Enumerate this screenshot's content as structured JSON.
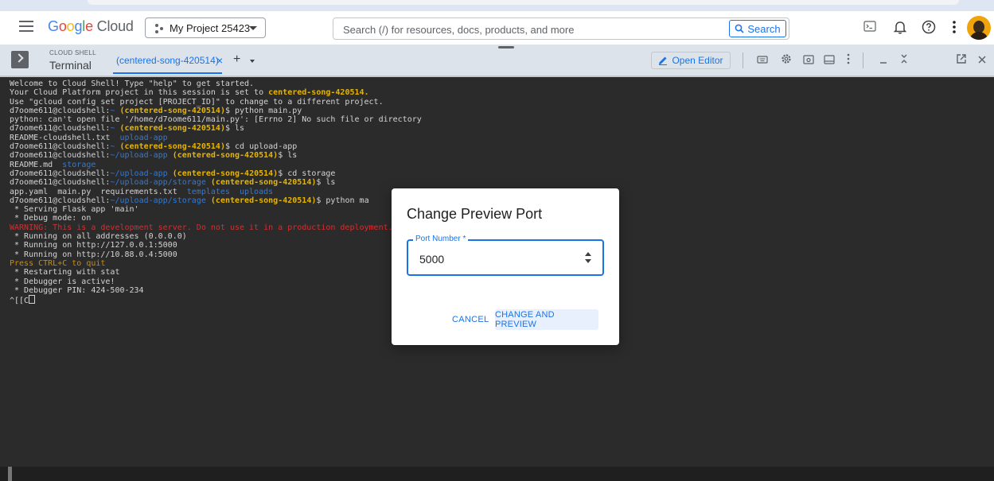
{
  "header": {
    "logo": {
      "g": "G",
      "o1": "o",
      "o2": "o",
      "g2": "g",
      "l": "l",
      "e": "e",
      "cloud": " Cloud"
    },
    "project_selector": "My Project 25423",
    "search_placeholder": "Search (/) for resources, docs, products, and more",
    "search_button": "Search"
  },
  "shell": {
    "section_label": "CLOUD SHELL",
    "title": "Terminal",
    "tab_label": "(centered-song-420514)",
    "tab_close": "×",
    "tab_add": "+",
    "open_editor": "Open Editor"
  },
  "terminal": {
    "user": "d7oome611@cloudshell",
    "project": "(centered-song-420514)",
    "lines": {
      "welcome": "Welcome to Cloud Shell! Type \"help\" to get started.",
      "project_set_prefix": "Your Cloud Platform project in this session is set to ",
      "project_id": "centered-song-420514.",
      "use_gcloud": "Use \"gcloud config set project [PROJECT_ID]\" to change to a different project.",
      "cmd_python": "python main.py",
      "error": "python: can't open file '/home/d7oome611/main.py': [Errno 2] No such file or directory",
      "cmd_ls": "ls",
      "ls1_file": "README-cloudshell.txt",
      "ls1_dir": "upload-app",
      "cmd_cd_upload": "cd upload-app",
      "ls2_file": "README.md",
      "ls2_dir": "storage",
      "cmd_cd_storage": "cd storage",
      "ls3_files": "app.yaml  main.py  requirements.txt",
      "ls3_dir1": "templates",
      "ls3_dir2": "uploads",
      "cmd_python_trunc": "python ma",
      "serving": " * Serving Flask app 'main'",
      "debug_mode": " * Debug mode: on",
      "warning": "WARNING: This is a development server. Do not use it in a production deployment. Use a production WSGI server instead.",
      "running_all": " * Running on all addresses (0.0.0.0)",
      "running_local": " * Running on http://127.0.0.1:5000",
      "running_ip": " * Running on http://10.88.0.4:5000",
      "press_ctrl": "Press CTRL+C to quit",
      "restarting": " * Restarting with stat",
      "debugger_active": " * Debugger is active!",
      "debugger_pin": " * Debugger PIN: 424-500-234",
      "last": "^[[C"
    },
    "paths": {
      "home": "~",
      "upload": "~/upload-app",
      "storage": "~/upload-app/storage"
    }
  },
  "dialog": {
    "title": "Change Preview Port",
    "field_label": "Port Number *",
    "port_value": "5000",
    "cancel": "CANCEL",
    "confirm": "CHANGE AND PREVIEW"
  },
  "colors": {
    "accent": "#1a73e8",
    "terminal_bg": "#2b2b2b",
    "project_yellow": "#e6b400",
    "dir_blue": "#2e7bdc"
  }
}
